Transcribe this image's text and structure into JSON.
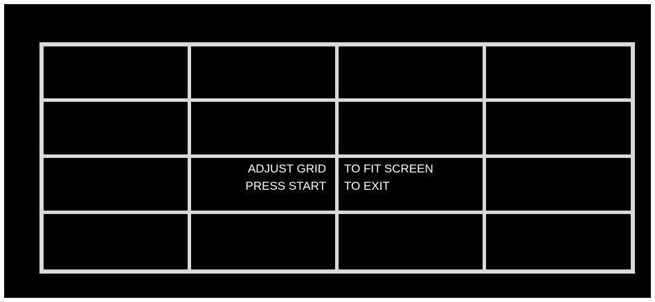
{
  "screen": {
    "background": "#000000",
    "grid_color": "#d9d9d9",
    "grid": {
      "rows": 4,
      "columns": 4
    },
    "message_left": {
      "line1": "ADJUST GRID",
      "line2": "PRESS START"
    },
    "message_right": {
      "line1": "TO FIT SCREEN",
      "line2": "TO EXIT"
    }
  }
}
